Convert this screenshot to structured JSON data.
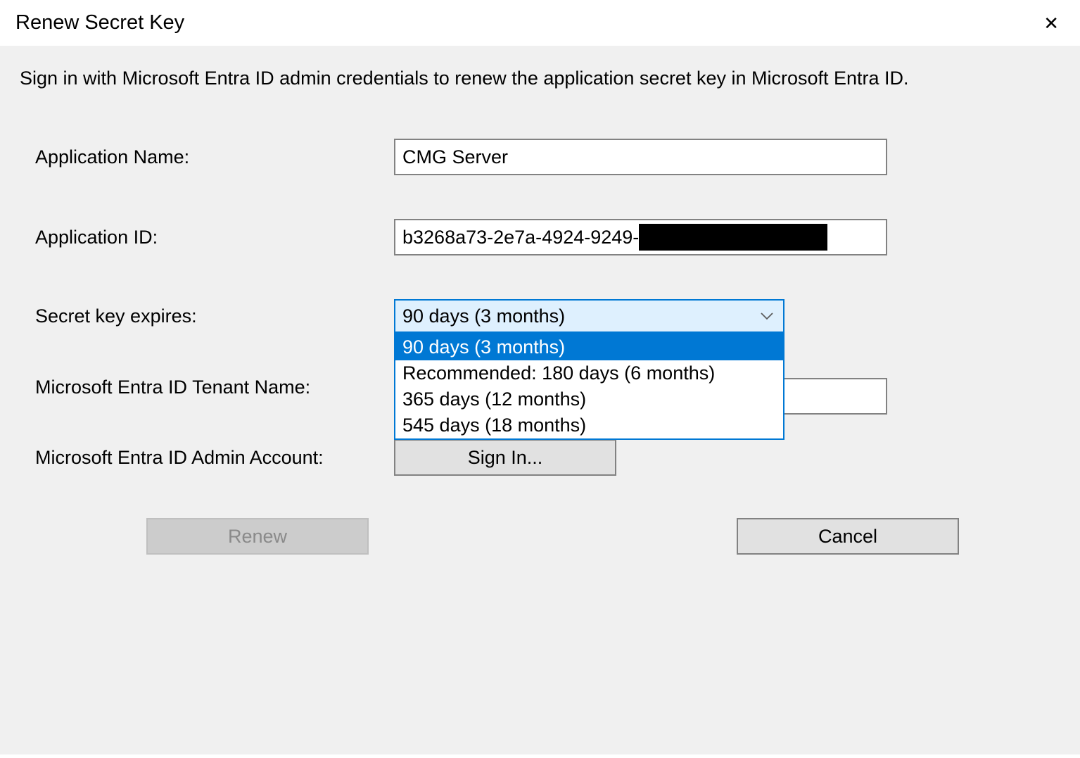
{
  "dialog": {
    "title": "Renew Secret Key",
    "description": "Sign in with Microsoft Entra ID admin credentials to renew the application secret key in Microsoft Entra ID."
  },
  "fields": {
    "appName": {
      "label": "Application Name:",
      "value": "CMG Server"
    },
    "appId": {
      "label": "Application ID:",
      "value": "b3268a73-2e7a-4924-9249-"
    },
    "expires": {
      "label": "Secret key expires:",
      "selected": "90 days (3 months)",
      "options": [
        "90 days (3 months)",
        "Recommended: 180 days (6 months)",
        "365 days (12 months)",
        "545 days (18 months)"
      ]
    },
    "tenant": {
      "label": "Microsoft Entra ID Tenant Name:"
    },
    "admin": {
      "label": "Microsoft Entra ID Admin Account:",
      "button": "Sign In..."
    }
  },
  "buttons": {
    "renew": "Renew",
    "cancel": "Cancel"
  }
}
